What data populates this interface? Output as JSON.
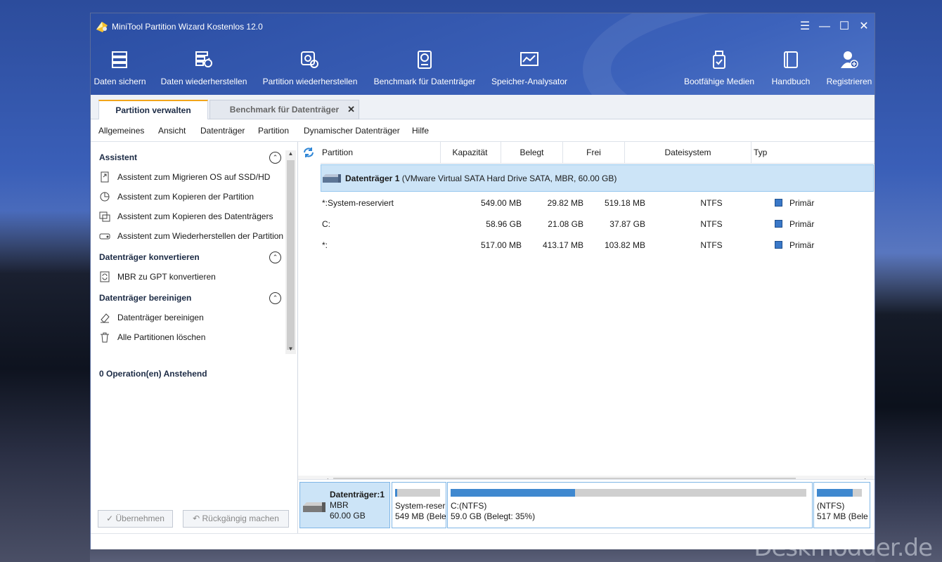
{
  "window": {
    "title": "MiniTool Partition Wizard Kostenlos 12.0"
  },
  "toolbar": {
    "left": [
      {
        "label": "Daten sichern",
        "icon": "backup-icon"
      },
      {
        "label": "Daten wiederherstellen",
        "icon": "data-recovery-icon"
      },
      {
        "label": "Partition wiederherstellen",
        "icon": "partition-recovery-icon"
      },
      {
        "label": "Benchmark für Datenträger",
        "icon": "benchmark-icon"
      },
      {
        "label": "Speicher-Analysator",
        "icon": "space-analyzer-icon"
      }
    ],
    "right": [
      {
        "label": "Bootfähige Medien",
        "icon": "bootable-media-icon"
      },
      {
        "label": "Handbuch",
        "icon": "manual-icon"
      },
      {
        "label": "Registrieren",
        "icon": "register-icon"
      }
    ]
  },
  "tabs": [
    {
      "label": "Partition verwalten",
      "active": true
    },
    {
      "label": "Benchmark für Datenträger",
      "active": false
    }
  ],
  "menu": [
    "Allgemeines",
    "Ansicht",
    "Datenträger",
    "Partition",
    "Dynamischer Datenträger",
    "Hilfe"
  ],
  "sidebar": {
    "sections": [
      {
        "title": "Assistent",
        "items": [
          {
            "label": "Assistent zum Migrieren OS auf SSD/HD",
            "icon": "migrate-os-icon"
          },
          {
            "label": "Assistent zum Kopieren der Partition",
            "icon": "copy-partition-icon"
          },
          {
            "label": "Assistent zum Kopieren des Datenträgers",
            "icon": "copy-disk-icon"
          },
          {
            "label": "Assistent zum Wiederherstellen der Partition",
            "icon": "recover-partition-icon"
          }
        ]
      },
      {
        "title": "Datenträger konvertieren",
        "items": [
          {
            "label": "MBR zu GPT konvertieren",
            "icon": "convert-icon"
          }
        ]
      },
      {
        "title": "Datenträger bereinigen",
        "items": [
          {
            "label": "Datenträger bereinigen",
            "icon": "eraser-icon"
          },
          {
            "label": "Alle Partitionen löschen",
            "icon": "trash-icon"
          }
        ]
      }
    ],
    "pending": "0 Operation(en) Anstehend",
    "apply_label": "Übernehmen",
    "undo_label": "Rückgängig machen"
  },
  "table": {
    "columns": [
      "Partition",
      "Kapazität",
      "Belegt",
      "Frei",
      "Dateisystem",
      "Typ"
    ],
    "disk": {
      "name": "Datenträger 1",
      "detail": "(VMware Virtual SATA Hard Drive SATA, MBR, 60.00 GB)"
    },
    "rows": [
      {
        "partition": "*:System-reserviert",
        "capacity": "549.00 MB",
        "used": "29.82 MB",
        "free": "519.18 MB",
        "fs": "NTFS",
        "type": "Primär"
      },
      {
        "partition": "C:",
        "capacity": "58.96 GB",
        "used": "21.08 GB",
        "free": "37.87 GB",
        "fs": "NTFS",
        "type": "Primär"
      },
      {
        "partition": "*:",
        "capacity": "517.00 MB",
        "used": "413.17 MB",
        "free": "103.82 MB",
        "fs": "NTFS",
        "type": "Primär"
      }
    ]
  },
  "diskmap": {
    "disk": {
      "name": "Datenträger:1",
      "scheme": "MBR",
      "size": "60.00 GB"
    },
    "parts": [
      {
        "line1": "System-reser",
        "line2": "549 MB (Bele",
        "used_fraction": 0.05
      },
      {
        "line1": "C:(NTFS)",
        "line2": "59.0 GB (Belegt: 35%)",
        "used_fraction": 0.35
      },
      {
        "line1": "(NTFS)",
        "line2": "517 MB (Bele",
        "used_fraction": 0.8
      }
    ]
  },
  "watermark": "Deskmodder.de",
  "colors": {
    "header": "#3559b0",
    "selected_row": "#cce4f7",
    "accent_tab": "#f2a51a",
    "usage_bar": "#3f88cf"
  }
}
